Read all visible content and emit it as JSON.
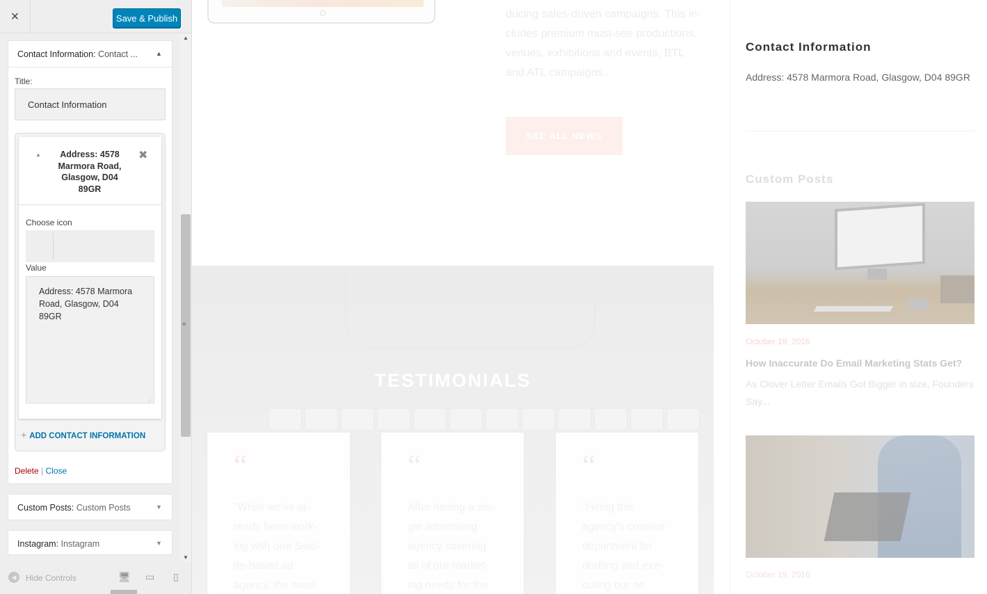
{
  "header": {
    "close_icon": "×",
    "publish_label": "Save & Publish"
  },
  "widget": {
    "title_prefix": "Contact Information:",
    "title_suffix": "Contact ...",
    "title_label": "Title:",
    "title_value": "Contact Information",
    "repeater_item_title": "Address: 4578 Marmora Road, Glasgow, D04 89GR",
    "choose_icon_label": "Choose icon",
    "value_label": "Value",
    "value_text": "Address: 4578 Marmora\nRoad, Glasgow, D04\n89GR",
    "add_label": "ADD CONTACT INFORMATION",
    "delete_label": "Delete",
    "separator": "|",
    "close_label": "Close"
  },
  "collapsed_widgets": [
    {
      "prefix": "Custom Posts:",
      "suffix": "Custom Posts"
    },
    {
      "prefix": "Instagram:",
      "suffix": "Instagram"
    }
  ],
  "footer": {
    "hide_label": "Hide Controls"
  },
  "preview": {
    "news_excerpt": "ducing sales-driven campaigns. This in-\ncludes premium must-see productions,\nvenues, exhibitions and events, BTL\nand ATL campaigns...",
    "see_all_label": "SEE ALL NEWS",
    "testimonials_title": "TESTIMONIALS",
    "testimonials": [
      {
        "quote_mark": "“",
        "text": "\"While we've al-\nready been work-\ning with one Seat-\ntle-based ad\nagency, the most"
      },
      {
        "quote_mark": "“",
        "text": "After having a sin-\ngle advertising\nagency covering\nall of our market-\ning needs for the"
      },
      {
        "quote_mark": "“",
        "text": "\"Hiring this\nagency's creative\ndepartment for\ndrafting and exe-\ncuting our ne"
      }
    ],
    "contact_title": "Contact Information",
    "contact_address": "Address: 4578 Marmora Road, Glasgow, D04 89GR",
    "custom_posts_title": "Custom Posts",
    "post1_date": "October 19, 2016",
    "post1_title": "How Inaccurate Do Email Marketing Stats Get?",
    "post1_excerpt": "As Clover Letter Emails Got Bigger in size, Founders\nSay...",
    "post2_date": "October 19, 2016"
  },
  "colors": {
    "primary": "#0085ba",
    "link": "#0073aa",
    "delete": "#aa0000"
  }
}
